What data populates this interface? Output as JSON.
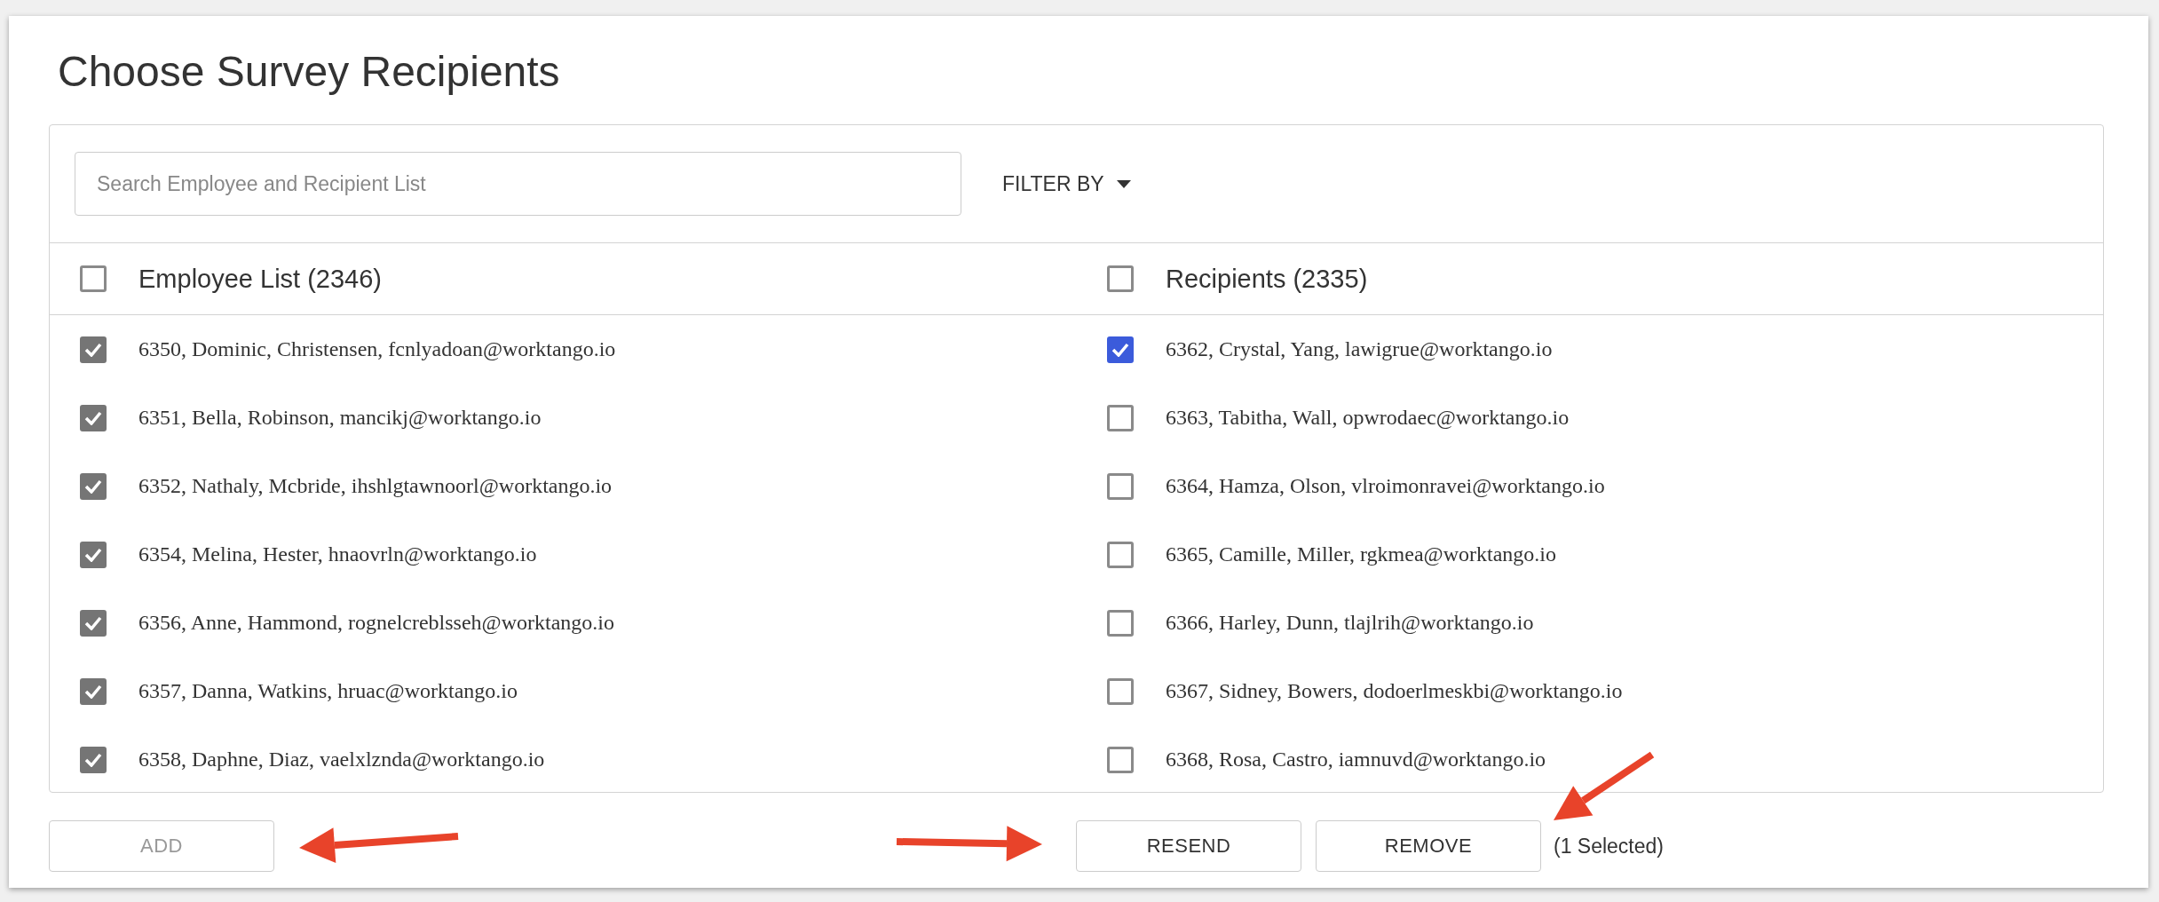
{
  "title": "Choose Survey Recipients",
  "search": {
    "placeholder": "Search Employee and Recipient List"
  },
  "filter": {
    "label": "FILTER BY"
  },
  "columns": [
    {
      "kind": "employees",
      "heading": "Employee List (2346)",
      "all_checked": false,
      "items": [
        {
          "text": "6350, Dominic, Christensen, fcnlyadoan@worktango.io",
          "checked": true
        },
        {
          "text": "6351, Bella, Robinson, mancikj@worktango.io",
          "checked": true
        },
        {
          "text": "6352, Nathaly, Mcbride, ihshlgtawnoorl@worktango.io",
          "checked": true
        },
        {
          "text": "6354, Melina, Hester, hnaovrln@worktango.io",
          "checked": true
        },
        {
          "text": "6356, Anne, Hammond, rognelcreblsseh@worktango.io",
          "checked": true
        },
        {
          "text": "6357, Danna, Watkins, hruac@worktango.io",
          "checked": true
        },
        {
          "text": "6358, Daphne, Diaz, vaelxlznda@worktango.io",
          "checked": true
        }
      ]
    },
    {
      "kind": "recipients",
      "heading": "Recipients (2335)",
      "all_checked": false,
      "items": [
        {
          "text": "6362, Crystal, Yang, lawigrue@worktango.io",
          "checked": true
        },
        {
          "text": "6363, Tabitha, Wall, opwrodaec@worktango.io",
          "checked": false
        },
        {
          "text": "6364, Hamza, Olson, vlroimonravei@worktango.io",
          "checked": false
        },
        {
          "text": "6365, Camille, Miller, rgkmea@worktango.io",
          "checked": false
        },
        {
          "text": "6366, Harley, Dunn, tlajlrih@worktango.io",
          "checked": false
        },
        {
          "text": "6367, Sidney, Bowers, dodoerlmeskbi@worktango.io",
          "checked": false
        },
        {
          "text": "6368, Rosa, Castro, iamnuvd@worktango.io",
          "checked": false
        }
      ]
    }
  ],
  "left_actions": [
    {
      "label": "ADD",
      "disabled": true
    }
  ],
  "right_actions": [
    {
      "label": "RESEND",
      "disabled": false
    },
    {
      "label": "REMOVE",
      "disabled": false
    }
  ],
  "selection_count": "(1 Selected)"
}
